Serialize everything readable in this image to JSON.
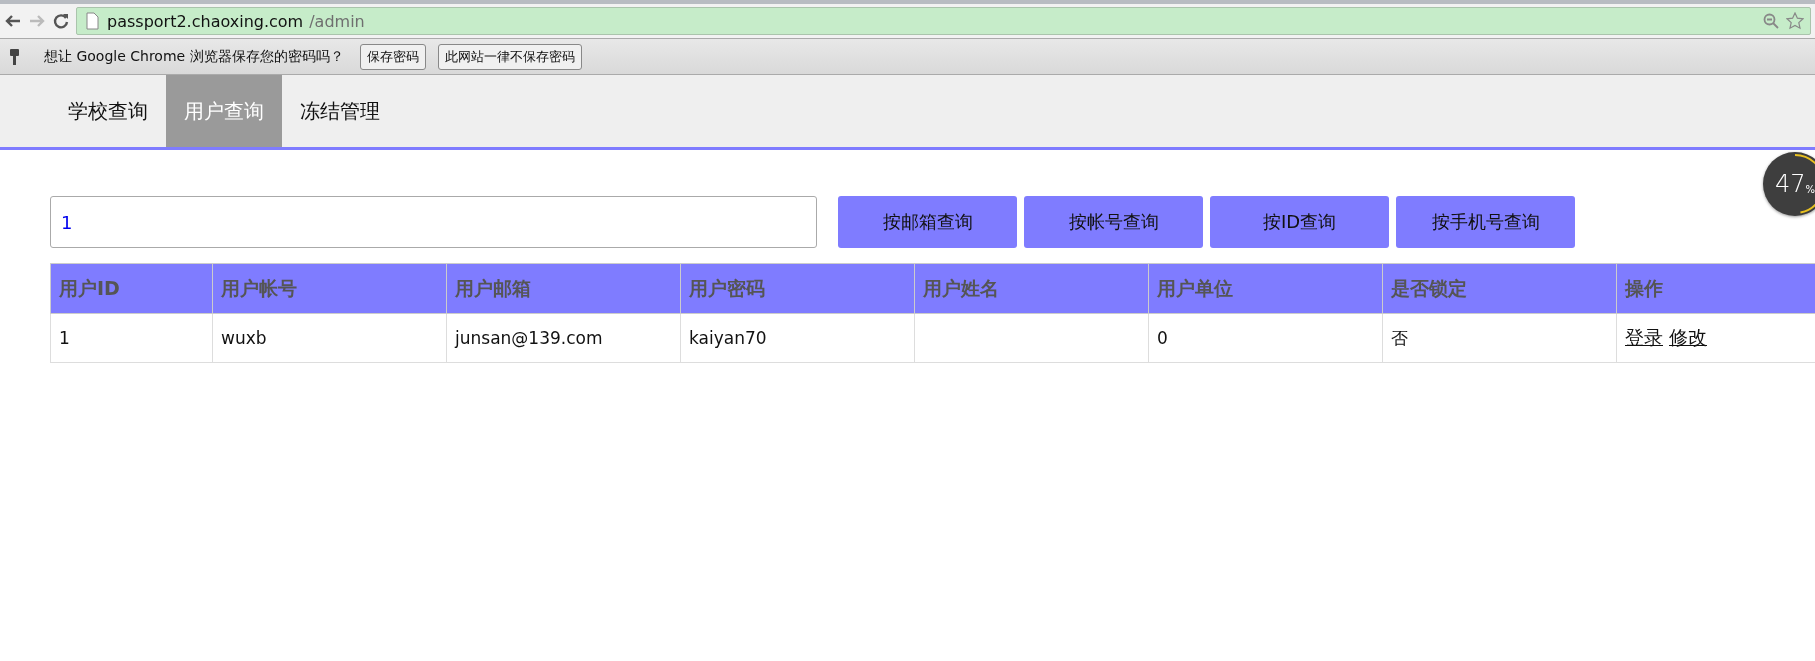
{
  "browser": {
    "url_host": "passport2.chaoxing.com",
    "url_path": "/admin"
  },
  "password_bar": {
    "message": "想让 Google Chrome 浏览器保存您的密码吗？",
    "buttons": [
      "保存密码",
      "此网站一律不保存密码"
    ]
  },
  "nav": {
    "tabs": [
      {
        "label": "学校查询",
        "selected": false
      },
      {
        "label": "用户查询",
        "selected": true
      },
      {
        "label": "冻结管理",
        "selected": false
      }
    ]
  },
  "search": {
    "value": "1",
    "buttons": [
      "按邮箱查询",
      "按帐号查询",
      "按ID查询",
      "按手机号查询"
    ]
  },
  "table": {
    "columns": [
      "用户ID",
      "用户帐号",
      "用户邮箱",
      "用户密码",
      "用户姓名",
      "用户单位",
      "是否锁定",
      "操作"
    ],
    "rows": [
      {
        "cells": [
          "1",
          "wuxb",
          "junsan@139.com",
          "kaiyan70",
          "",
          "0",
          "否"
        ],
        "actions": [
          "登录",
          "修改"
        ]
      }
    ]
  },
  "memory_widget": {
    "value": "47",
    "unit": "%",
    "level": 0.47
  }
}
